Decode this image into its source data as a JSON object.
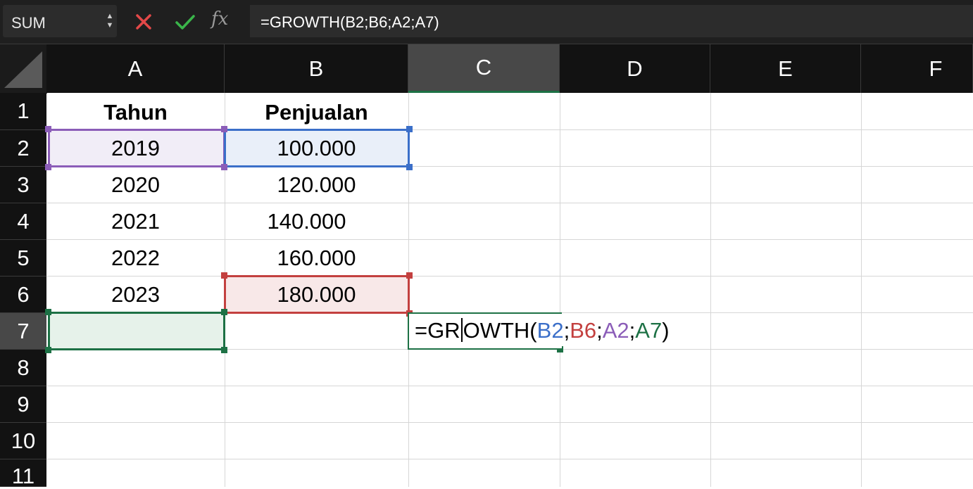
{
  "formula_bar": {
    "name_box": "SUM",
    "cancel_icon": "x-icon",
    "confirm_icon": "check-icon",
    "fx_label": "fx",
    "formula": "=GROWTH(B2;B6;A2;A7)"
  },
  "columns": [
    "A",
    "B",
    "C",
    "D",
    "E",
    "F"
  ],
  "rows": [
    "1",
    "2",
    "3",
    "4",
    "5",
    "6",
    "7",
    "8",
    "9",
    "10",
    "11"
  ],
  "cells": {
    "A1": "Tahun",
    "B1": "Penjualan",
    "A2": "2019",
    "B2": "100.000",
    "A3": "2020",
    "B3": "120.000",
    "A4": "2021",
    "B4": "140.000",
    "A5": "2022",
    "B5": "160.000",
    "A6": "2023",
    "B6": "180.000"
  },
  "editor": {
    "prefix": "=GR",
    "suffix": "OWTH(",
    "arg1": "B2",
    "sep": ";",
    "arg2": "B6",
    "arg3": "A2",
    "arg4": "A7",
    "close": ")"
  },
  "colors": {
    "ref_b2": "#3b6fc9",
    "ref_b6": "#c3403f",
    "ref_a2": "#8b5db8",
    "ref_a7": "#1d7145",
    "active_header": "#484848"
  }
}
